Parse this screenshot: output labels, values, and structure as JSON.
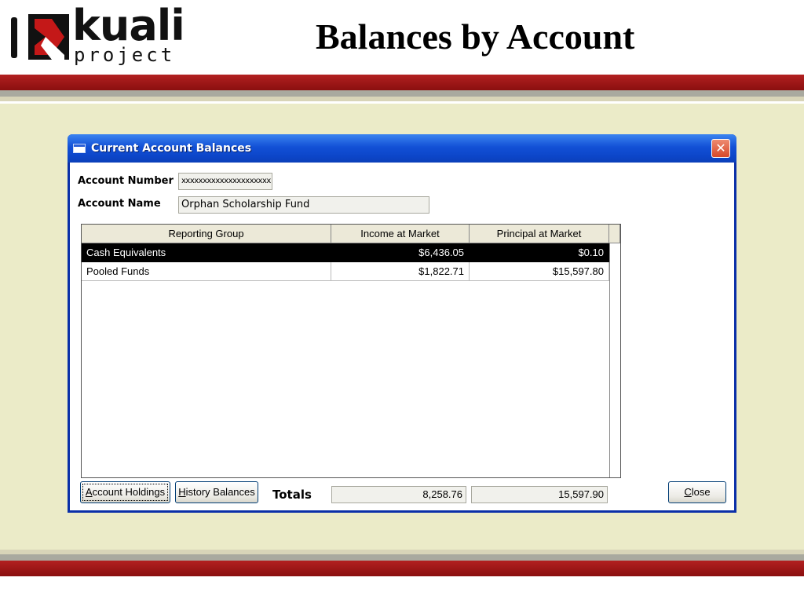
{
  "slide": {
    "logo_word": "kuali",
    "logo_sub": "project",
    "title": "Balances by Account"
  },
  "colors": {
    "accent_red": "#a01818",
    "title_bar_blue": "#0c45c8",
    "content_beige": "#ebebc8"
  },
  "window": {
    "title": "Current Account Balances",
    "close_glyph": "✕",
    "form": {
      "account_number_label": "Account Number",
      "account_number_value": "xxxxxxxxxxxxxxxxxxxxx",
      "account_name_label": "Account Name",
      "account_name_value": "Orphan Scholarship Fund"
    },
    "grid": {
      "columns": [
        "Reporting Group",
        "Income at Market",
        "Principal at Market"
      ],
      "rows": [
        {
          "group": "Cash Equivalents",
          "income": "$6,436.05",
          "principal": "$0.10",
          "selected": true
        },
        {
          "group": "Pooled Funds",
          "income": "$1,822.71",
          "principal": "$15,597.80",
          "selected": false
        }
      ]
    },
    "buttons": {
      "account_holdings": "Account Holdings",
      "history_balances": "History Balances",
      "close": "Close"
    },
    "totals": {
      "label": "Totals",
      "income": "8,258.76",
      "principal": "15,597.90"
    }
  }
}
